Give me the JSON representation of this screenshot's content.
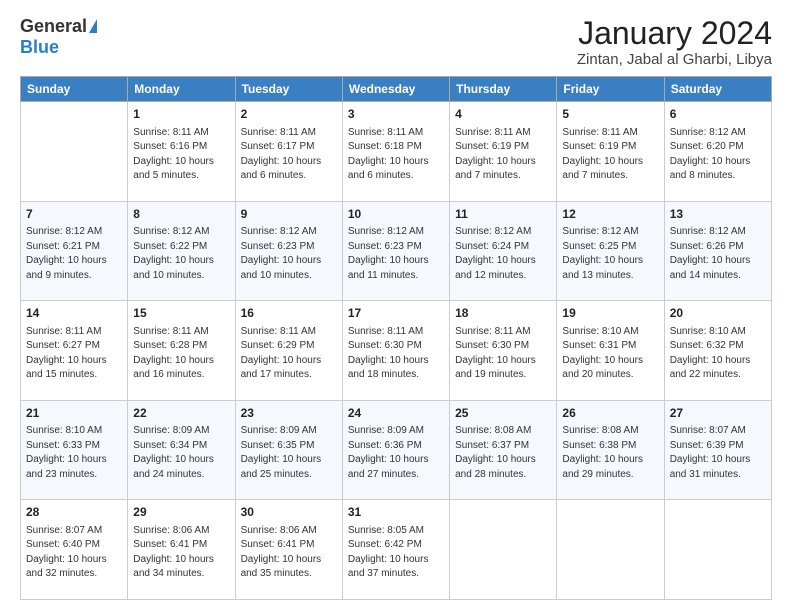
{
  "header": {
    "logo_general": "General",
    "logo_blue": "Blue",
    "month_title": "January 2024",
    "location": "Zintan, Jabal al Gharbi, Libya"
  },
  "days_of_week": [
    "Sunday",
    "Monday",
    "Tuesday",
    "Wednesday",
    "Thursday",
    "Friday",
    "Saturday"
  ],
  "weeks": [
    [
      {
        "day": "",
        "info": ""
      },
      {
        "day": "1",
        "info": "Sunrise: 8:11 AM\nSunset: 6:16 PM\nDaylight: 10 hours\nand 5 minutes."
      },
      {
        "day": "2",
        "info": "Sunrise: 8:11 AM\nSunset: 6:17 PM\nDaylight: 10 hours\nand 6 minutes."
      },
      {
        "day": "3",
        "info": "Sunrise: 8:11 AM\nSunset: 6:18 PM\nDaylight: 10 hours\nand 6 minutes."
      },
      {
        "day": "4",
        "info": "Sunrise: 8:11 AM\nSunset: 6:19 PM\nDaylight: 10 hours\nand 7 minutes."
      },
      {
        "day": "5",
        "info": "Sunrise: 8:11 AM\nSunset: 6:19 PM\nDaylight: 10 hours\nand 7 minutes."
      },
      {
        "day": "6",
        "info": "Sunrise: 8:12 AM\nSunset: 6:20 PM\nDaylight: 10 hours\nand 8 minutes."
      }
    ],
    [
      {
        "day": "7",
        "info": "Sunrise: 8:12 AM\nSunset: 6:21 PM\nDaylight: 10 hours\nand 9 minutes."
      },
      {
        "day": "8",
        "info": "Sunrise: 8:12 AM\nSunset: 6:22 PM\nDaylight: 10 hours\nand 10 minutes."
      },
      {
        "day": "9",
        "info": "Sunrise: 8:12 AM\nSunset: 6:23 PM\nDaylight: 10 hours\nand 10 minutes."
      },
      {
        "day": "10",
        "info": "Sunrise: 8:12 AM\nSunset: 6:23 PM\nDaylight: 10 hours\nand 11 minutes."
      },
      {
        "day": "11",
        "info": "Sunrise: 8:12 AM\nSunset: 6:24 PM\nDaylight: 10 hours\nand 12 minutes."
      },
      {
        "day": "12",
        "info": "Sunrise: 8:12 AM\nSunset: 6:25 PM\nDaylight: 10 hours\nand 13 minutes."
      },
      {
        "day": "13",
        "info": "Sunrise: 8:12 AM\nSunset: 6:26 PM\nDaylight: 10 hours\nand 14 minutes."
      }
    ],
    [
      {
        "day": "14",
        "info": "Sunrise: 8:11 AM\nSunset: 6:27 PM\nDaylight: 10 hours\nand 15 minutes."
      },
      {
        "day": "15",
        "info": "Sunrise: 8:11 AM\nSunset: 6:28 PM\nDaylight: 10 hours\nand 16 minutes."
      },
      {
        "day": "16",
        "info": "Sunrise: 8:11 AM\nSunset: 6:29 PM\nDaylight: 10 hours\nand 17 minutes."
      },
      {
        "day": "17",
        "info": "Sunrise: 8:11 AM\nSunset: 6:30 PM\nDaylight: 10 hours\nand 18 minutes."
      },
      {
        "day": "18",
        "info": "Sunrise: 8:11 AM\nSunset: 6:30 PM\nDaylight: 10 hours\nand 19 minutes."
      },
      {
        "day": "19",
        "info": "Sunrise: 8:10 AM\nSunset: 6:31 PM\nDaylight: 10 hours\nand 20 minutes."
      },
      {
        "day": "20",
        "info": "Sunrise: 8:10 AM\nSunset: 6:32 PM\nDaylight: 10 hours\nand 22 minutes."
      }
    ],
    [
      {
        "day": "21",
        "info": "Sunrise: 8:10 AM\nSunset: 6:33 PM\nDaylight: 10 hours\nand 23 minutes."
      },
      {
        "day": "22",
        "info": "Sunrise: 8:09 AM\nSunset: 6:34 PM\nDaylight: 10 hours\nand 24 minutes."
      },
      {
        "day": "23",
        "info": "Sunrise: 8:09 AM\nSunset: 6:35 PM\nDaylight: 10 hours\nand 25 minutes."
      },
      {
        "day": "24",
        "info": "Sunrise: 8:09 AM\nSunset: 6:36 PM\nDaylight: 10 hours\nand 27 minutes."
      },
      {
        "day": "25",
        "info": "Sunrise: 8:08 AM\nSunset: 6:37 PM\nDaylight: 10 hours\nand 28 minutes."
      },
      {
        "day": "26",
        "info": "Sunrise: 8:08 AM\nSunset: 6:38 PM\nDaylight: 10 hours\nand 29 minutes."
      },
      {
        "day": "27",
        "info": "Sunrise: 8:07 AM\nSunset: 6:39 PM\nDaylight: 10 hours\nand 31 minutes."
      }
    ],
    [
      {
        "day": "28",
        "info": "Sunrise: 8:07 AM\nSunset: 6:40 PM\nDaylight: 10 hours\nand 32 minutes."
      },
      {
        "day": "29",
        "info": "Sunrise: 8:06 AM\nSunset: 6:41 PM\nDaylight: 10 hours\nand 34 minutes."
      },
      {
        "day": "30",
        "info": "Sunrise: 8:06 AM\nSunset: 6:41 PM\nDaylight: 10 hours\nand 35 minutes."
      },
      {
        "day": "31",
        "info": "Sunrise: 8:05 AM\nSunset: 6:42 PM\nDaylight: 10 hours\nand 37 minutes."
      },
      {
        "day": "",
        "info": ""
      },
      {
        "day": "",
        "info": ""
      },
      {
        "day": "",
        "info": ""
      }
    ]
  ]
}
